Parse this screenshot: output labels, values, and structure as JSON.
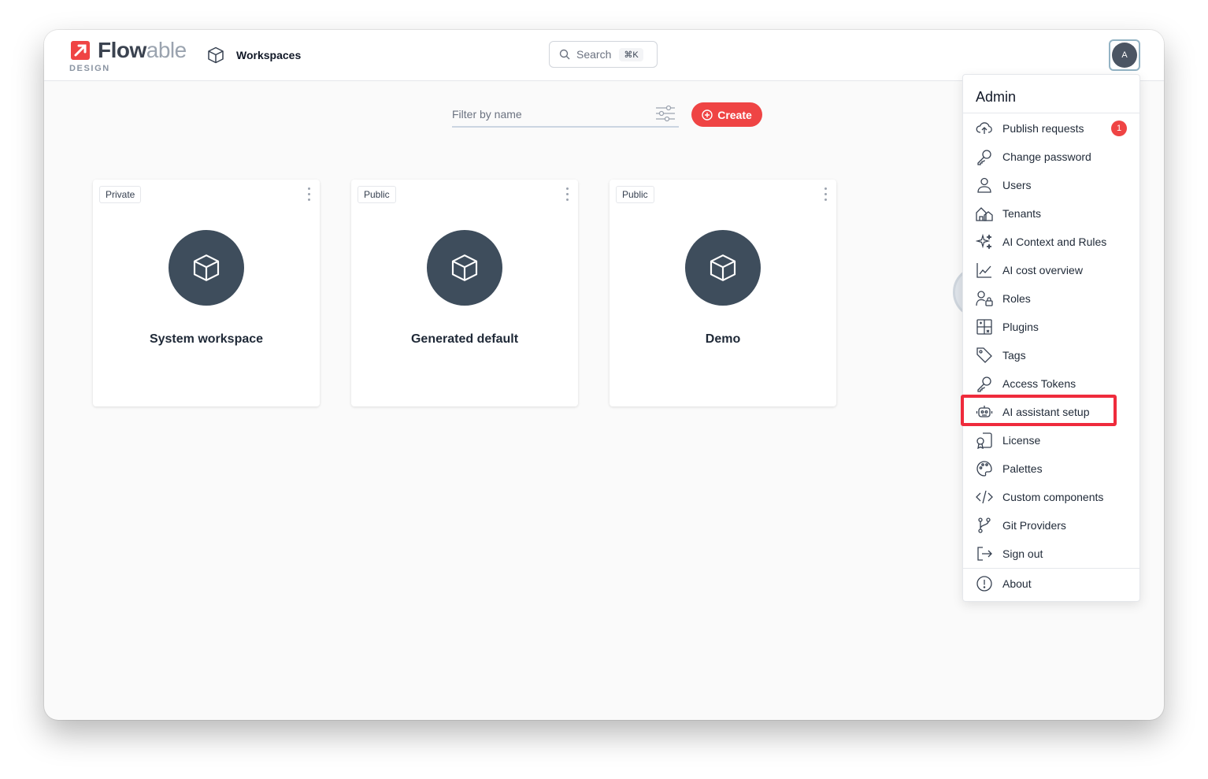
{
  "app": {
    "logo_text_main": "Flow",
    "logo_text_accent": "able",
    "logo_sub": "DESIGN",
    "brand_color": "#ef4444"
  },
  "nav": {
    "workspaces_label": "Workspaces",
    "workspaces_icon": "cube-icon"
  },
  "search": {
    "label": "Search",
    "shortcut": "⌘K"
  },
  "user": {
    "avatar_initial": "A"
  },
  "toolbar": {
    "filter_placeholder": "Filter by name",
    "create_label": "Create"
  },
  "workspaces": [
    {
      "visibility": "Private",
      "name": "System workspace"
    },
    {
      "visibility": "Public",
      "name": "Generated default"
    },
    {
      "visibility": "Public",
      "name": "Demo"
    }
  ],
  "admin_menu": {
    "title": "Admin",
    "items": [
      {
        "label": "Publish requests",
        "icon": "cloud-upload-icon",
        "badge": "1"
      },
      {
        "label": "Change password",
        "icon": "key-icon"
      },
      {
        "label": "Users",
        "icon": "user-icon"
      },
      {
        "label": "Tenants",
        "icon": "houses-icon"
      },
      {
        "label": "AI Context and Rules",
        "icon": "sparkles-icon"
      },
      {
        "label": "AI cost overview",
        "icon": "line-chart-icon"
      },
      {
        "label": "Roles",
        "icon": "user-lock-icon"
      },
      {
        "label": "Plugins",
        "icon": "puzzle-icon"
      },
      {
        "label": "Tags",
        "icon": "tag-icon"
      },
      {
        "label": "Access Tokens",
        "icon": "key-icon"
      },
      {
        "label": "AI assistant setup",
        "icon": "robot-icon",
        "highlighted": true
      },
      {
        "label": "License",
        "icon": "license-icon"
      },
      {
        "label": "Palettes",
        "icon": "palette-icon"
      },
      {
        "label": "Custom components",
        "icon": "code-icon"
      },
      {
        "label": "Git Providers",
        "icon": "git-branch-icon"
      },
      {
        "label": "Sign out",
        "icon": "sign-out-icon"
      }
    ],
    "footer_item": {
      "label": "About",
      "icon": "info-circle-icon"
    }
  },
  "highlight_color": "#ef2b3c"
}
